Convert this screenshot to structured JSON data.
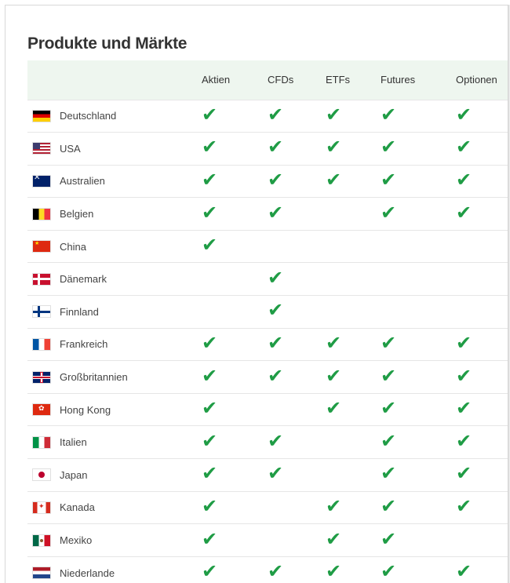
{
  "title": "Produkte und Märkte",
  "columns": [
    "Aktien",
    "CFDs",
    "ETFs",
    "Futures",
    "Optionen"
  ],
  "check_symbol": "✔",
  "colors": {
    "check": "#1f9c45",
    "header_bg": "#eef6ef"
  },
  "rows": [
    {
      "country": "Deutschland",
      "flag": "f-de",
      "checks": [
        true,
        true,
        true,
        true,
        true
      ]
    },
    {
      "country": "USA",
      "flag": "f-us",
      "checks": [
        true,
        true,
        true,
        true,
        true
      ]
    },
    {
      "country": "Australien",
      "flag": "f-au",
      "checks": [
        true,
        true,
        true,
        true,
        true
      ]
    },
    {
      "country": "Belgien",
      "flag": "f-be",
      "checks": [
        true,
        true,
        false,
        true,
        true
      ]
    },
    {
      "country": "China",
      "flag": "f-cn",
      "checks": [
        true,
        false,
        false,
        false,
        false
      ]
    },
    {
      "country": "Dänemark",
      "flag": "f-dk",
      "checks": [
        false,
        true,
        false,
        false,
        false
      ]
    },
    {
      "country": "Finnland",
      "flag": "f-fi",
      "checks": [
        false,
        true,
        false,
        false,
        false
      ]
    },
    {
      "country": "Frankreich",
      "flag": "f-fr",
      "checks": [
        true,
        true,
        true,
        true,
        true
      ]
    },
    {
      "country": "Großbritannien",
      "flag": "f-gb",
      "checks": [
        true,
        true,
        true,
        true,
        true
      ]
    },
    {
      "country": "Hong Kong",
      "flag": "f-hk",
      "checks": [
        true,
        false,
        true,
        true,
        true
      ]
    },
    {
      "country": "Italien",
      "flag": "f-it",
      "checks": [
        true,
        true,
        false,
        true,
        true
      ]
    },
    {
      "country": "Japan",
      "flag": "f-jp",
      "checks": [
        true,
        true,
        false,
        true,
        true
      ]
    },
    {
      "country": "Kanada",
      "flag": "f-ca",
      "checks": [
        true,
        false,
        true,
        true,
        true
      ]
    },
    {
      "country": "Mexiko",
      "flag": "f-mx",
      "checks": [
        true,
        false,
        true,
        true,
        false
      ]
    },
    {
      "country": "Niederlande",
      "flag": "f-nl",
      "checks": [
        true,
        true,
        true,
        true,
        true
      ]
    }
  ]
}
